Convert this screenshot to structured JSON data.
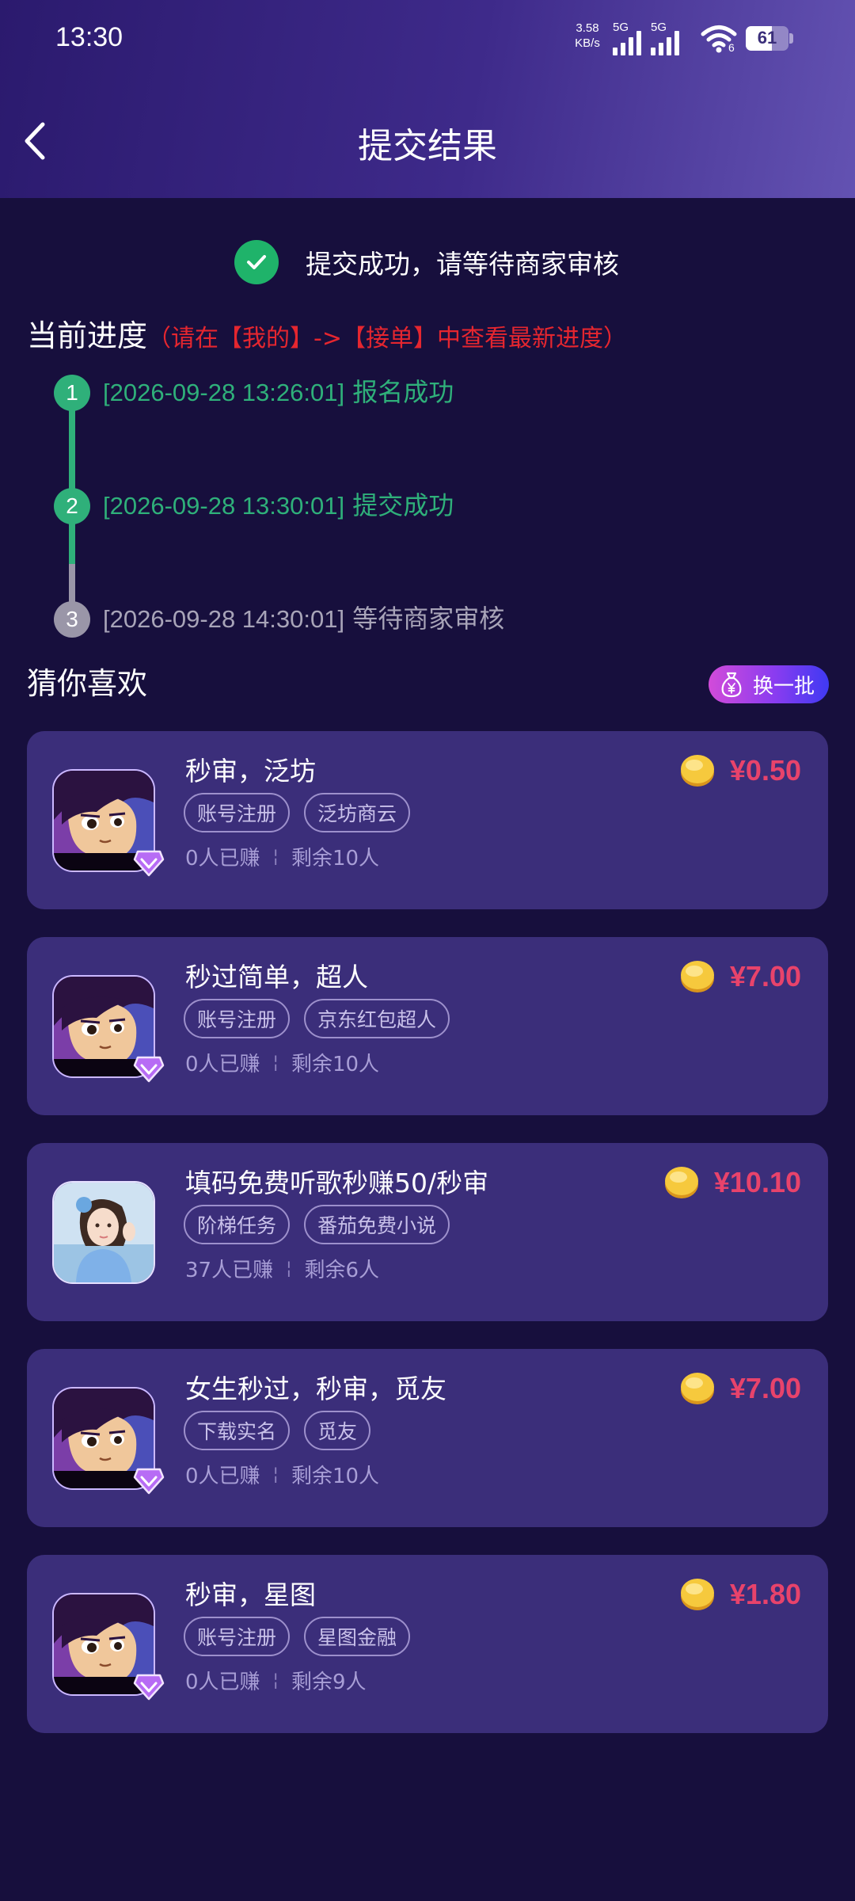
{
  "status_bar": {
    "time": "13:30",
    "net_speed_value": "3.58",
    "net_speed_unit": "KB/s",
    "sim1_label": "5G",
    "sim2_label": "5G",
    "wifi_label": "6",
    "battery_level": "61",
    "battery_fraction": 0.61
  },
  "header": {
    "title": "提交结果"
  },
  "success": {
    "text": "提交成功，请等待商家审核"
  },
  "progress": {
    "title": "当前进度",
    "hint": "（请在【我的】->【接单】中查看最新进度）",
    "steps": [
      {
        "index": "1",
        "timestamp": "[2026-09-28 13:26:01]",
        "label": "报名成功",
        "status": "done",
        "color": "#2fb07a"
      },
      {
        "index": "2",
        "timestamp": "[2026-09-28 13:30:01]",
        "label": "提交成功",
        "status": "done",
        "color": "#2fb07a"
      },
      {
        "index": "3",
        "timestamp": "[2026-09-28 14:30:01]",
        "label": "等待商家审核",
        "status": "pending",
        "color": "#9a96a8"
      }
    ]
  },
  "recommend": {
    "title": "猜你喜欢",
    "refresh_label": "换一批",
    "items": [
      {
        "title": "秒审，泛坊",
        "tags": [
          "账号注册",
          "泛坊商云"
        ],
        "earned": "0人已赚",
        "remaining": "剩余10人",
        "price": "¥0.50",
        "avatar": "anime-boy"
      },
      {
        "title": "秒过简单，超人",
        "tags": [
          "账号注册",
          "京东红包超人"
        ],
        "earned": "0人已赚",
        "remaining": "剩余10人",
        "price": "¥7.00",
        "avatar": "anime-boy"
      },
      {
        "title": "填码免费听歌秒赚50/秒审",
        "tags": [
          "阶梯任务",
          "番茄免费小说"
        ],
        "earned": "37人已赚",
        "remaining": "剩余6人",
        "price": "¥10.10",
        "avatar": "girl-photo"
      },
      {
        "title": "女生秒过，秒审，觅友",
        "tags": [
          "下载实名",
          "觅友"
        ],
        "earned": "0人已赚",
        "remaining": "剩余10人",
        "price": "¥7.00",
        "avatar": "anime-boy"
      },
      {
        "title": "秒审，星图",
        "tags": [
          "账号注册",
          "星图金融"
        ],
        "earned": "0人已赚",
        "remaining": "剩余9人",
        "price": "¥1.80",
        "avatar": "anime-boy"
      }
    ]
  },
  "colors": {
    "background": "#170f3d",
    "card": "#3b2e7a",
    "success_green": "#1fb36a",
    "hint_red": "#e5262f",
    "price_red": "#e8436b"
  }
}
